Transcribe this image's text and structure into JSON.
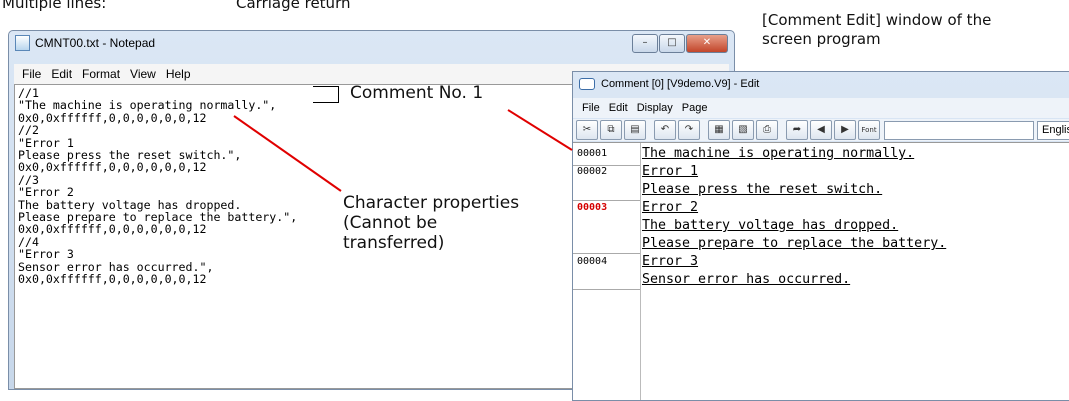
{
  "labels": {
    "multiple_lines": "Multiple lines:",
    "carriage_return": "Carriage return",
    "comment_edit_window_line1": "[Comment Edit] window of the",
    "comment_edit_window_line2": "screen program",
    "comment_no": "Comment No. 1",
    "char_props_line1": "Character properties",
    "char_props_line2": "(Cannot be",
    "char_props_line3": "transferred)"
  },
  "notepad": {
    "title": "CMNT00.txt - Notepad",
    "menu": [
      "File",
      "Edit",
      "Format",
      "View",
      "Help"
    ],
    "text": "//1\n\"The machine is operating normally.\",\n0x0,0xffffff,0,0,0,0,0,0,12\n//2\n\"Error 1\nPlease press the reset switch.\",\n0x0,0xffffff,0,0,0,0,0,0,12\n//3\n\"Error 2\nThe battery voltage has dropped.\nPlease prepare to replace the battery.\",\n0x0,0xffffff,0,0,0,0,0,0,12\n//4\n\"Error 3\nSensor error has occurred.\",\n0x0,0xffffff,0,0,0,0,0,0,12"
  },
  "comment_edit": {
    "title": "Comment [0] [V9demo.V9] - Edit",
    "menu": [
      "File",
      "Edit",
      "Display",
      "Page"
    ],
    "toolbar_font_label": "Font",
    "language": "English",
    "numbers": [
      "00001",
      "00002",
      "00003",
      "00004"
    ],
    "lines": [
      "The machine is operating normally.",
      "Error 1",
      "Please press the reset switch.",
      "Error 2",
      "The battery voltage has dropped.",
      "Please prepare to replace the battery.",
      "Error 3",
      "Sensor error has occurred."
    ]
  },
  "colors": {
    "annotation_line": "#e00000",
    "selected_number": "#d40000"
  }
}
